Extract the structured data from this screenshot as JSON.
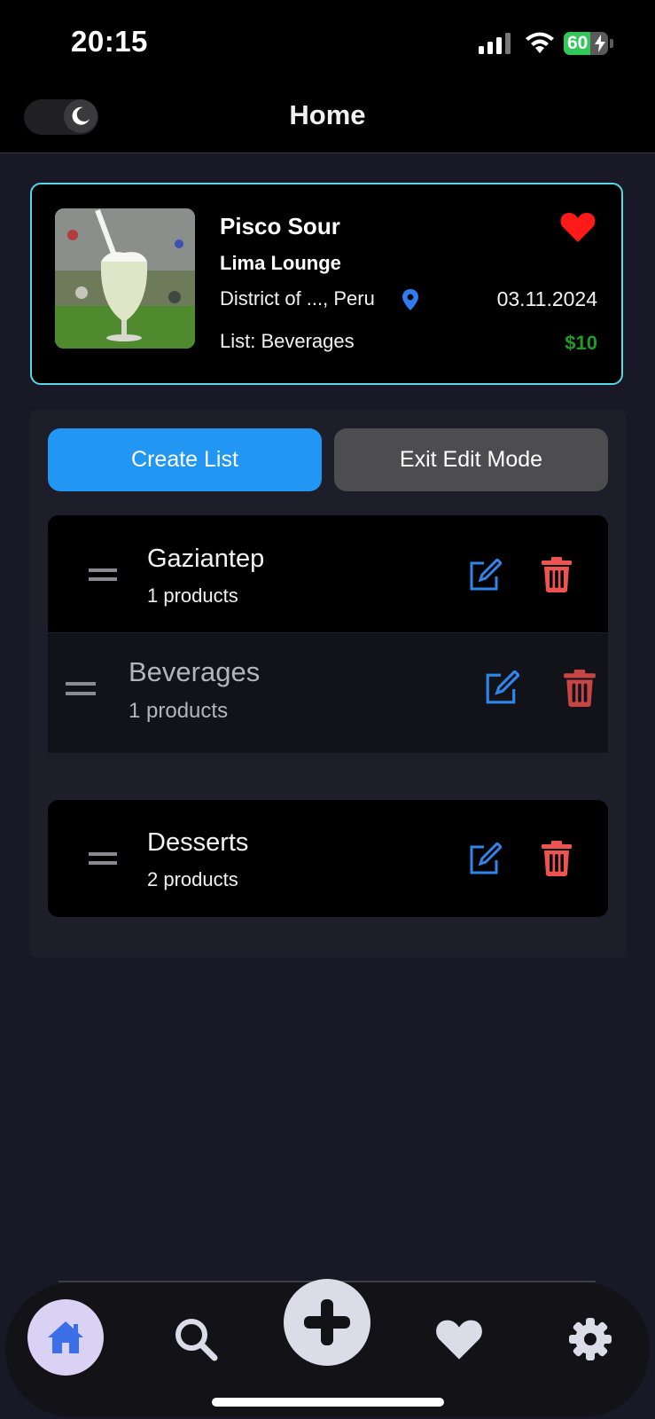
{
  "status_bar": {
    "time": "20:15",
    "battery": "60",
    "battery_level": 0.6
  },
  "header": {
    "title": "Home",
    "theme_icon": "moon-icon"
  },
  "featured_card": {
    "name": "Pisco Sour",
    "venue": "Lima Lounge",
    "location": "District of ..., Peru",
    "list": "List: Beverages",
    "date": "03.11.2024",
    "price": "$10",
    "favorite_icon": "heart-icon",
    "colors": {
      "border": "#56d8e6",
      "heart": "#ff1a1a",
      "price": "#1f9b2a",
      "pin": "#2f7bf0"
    }
  },
  "actions": {
    "create_label": "Create List",
    "exit_label": "Exit Edit Mode"
  },
  "lists": [
    {
      "title": "Gaziantep",
      "count": "1 products"
    },
    {
      "title": "Beverages",
      "count": "1 products"
    },
    {
      "title": "Desserts",
      "count": "2 products"
    }
  ],
  "tabbar": {
    "items": [
      "home-icon",
      "search-icon",
      "plus-icon",
      "heart-icon",
      "gear-icon"
    ],
    "active": "home-icon",
    "accent": "#3b6fe8"
  }
}
